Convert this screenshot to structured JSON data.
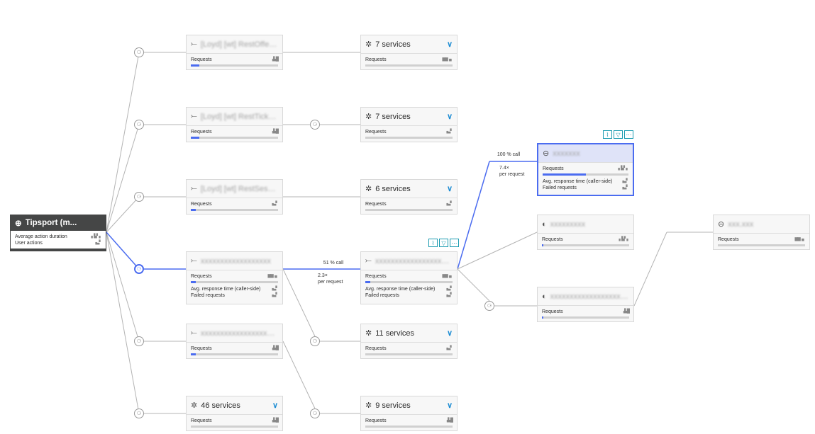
{
  "colors": {
    "accent": "#4b6cf0",
    "edge": "#b4b4b4",
    "action_border": "#1a9bb0",
    "dark_node": "#454646"
  },
  "app": {
    "title": "Tipsport (m...",
    "metrics": {
      "avg_action_duration": "Average action duration",
      "user_actions": "User actions"
    },
    "icon": "globe-icon"
  },
  "labels": {
    "requests": "Requests",
    "avg_response": "Avg. response time (caller-side)",
    "failed": "Failed requests"
  },
  "col1": {
    "svc1": {
      "name": "[Loyd] [wt] RestOfferApi",
      "request_share": 0.1
    },
    "svc2": {
      "name": "[Loyd] [wt] RestTicketBuild...",
      "request_share": 0.1
    },
    "svc3": {
      "name": "[Loyd] [wt] RestSessApi",
      "request_share": 0.06
    },
    "svc4": {
      "name": "xxxxxxxxxxxxxxxxxx",
      "request_share": 0.06
    },
    "svc5": {
      "name": "xxxxxxxxxxxxxxxxxxxxx",
      "request_share": 0.06
    },
    "svc6": {
      "services": "46 services",
      "request_share": 0.0
    }
  },
  "col2": {
    "svc1": {
      "services": "7 services",
      "request_share": 0.0
    },
    "svc2": {
      "services": "7 services",
      "request_share": 0.0
    },
    "svc3": {
      "services": "6 services",
      "request_share": 0.0
    },
    "svc4": {
      "name": "xxxxxxxxxxxxxxxxxxxxxxx",
      "request_share": 0.06
    },
    "svc5": {
      "services": "11 services",
      "request_share": 0.0
    },
    "svc6": {
      "services": "9 services",
      "request_share": 0.0
    }
  },
  "col3": {
    "db1": {
      "name": "xxxxxxx",
      "request_share": 0.5
    },
    "db2": {
      "name": "xxxxxxxxx",
      "request_share": 0.02
    },
    "db3": {
      "name": "xxxxxxxxxxxxxxxxxxxxxxxx",
      "request_share": 0.02
    }
  },
  "col4": {
    "db1": {
      "name": "xxx.xxx",
      "request_share": 0.0
    }
  },
  "calls": {
    "c1": {
      "pct": "51 % call",
      "rate": "2.3×",
      "per": "per request"
    },
    "c2": {
      "pct": "100 % call",
      "rate": "7.4×",
      "per": "per request"
    }
  },
  "glyphs": {
    "service": "⤚",
    "services": "✲",
    "chevron": "∨",
    "db": "⊖",
    "half": "◐",
    "hub": "⚆",
    "mini_a": "▖▙▘▖",
    "mini_b": "▗▙█",
    "mini_c": "▆▆▗▖",
    "mini_d": "▗▃▘",
    "act_chart": "⌇",
    "act_filter": "▽",
    "act_more": "⋯"
  }
}
